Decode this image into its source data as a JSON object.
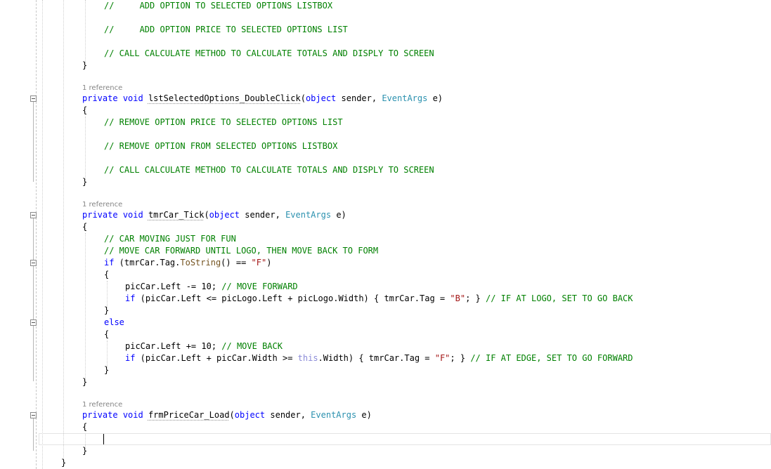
{
  "editor": {
    "lines": [
      {
        "tokens": [
          {
            "t": "//     ADD OPTION TO SELECTED OPTIONS LISTBOX",
            "c": "cm"
          }
        ]
      },
      {
        "tokens": [
          {
            "t": "//     ADD OPTION PRICE TO SELECTED OPTIONS LIST",
            "c": "cm"
          }
        ]
      },
      {
        "tokens": [
          {
            "t": "// CALL CALCULATE METHOD TO CALCULATE TOTALS AND DISPLY TO SCREEN",
            "c": "cm"
          }
        ]
      },
      {
        "tokens": [
          {
            "t": "}",
            "c": ""
          }
        ]
      },
      {
        "tokens": [
          {
            "t": "private",
            "c": "kw"
          },
          {
            "t": " ",
            "c": ""
          },
          {
            "t": "void",
            "c": "kw"
          },
          {
            "t": " ",
            "c": ""
          },
          {
            "t": "lstSelectedOptions_DoubleClick",
            "c": "mname"
          },
          {
            "t": "(",
            "c": ""
          },
          {
            "t": "object",
            "c": "kw"
          },
          {
            "t": " sender, ",
            "c": ""
          },
          {
            "t": "EventArgs",
            "c": "ty"
          },
          {
            "t": " e)",
            "c": ""
          }
        ]
      },
      {
        "tokens": [
          {
            "t": "{",
            "c": ""
          }
        ]
      },
      {
        "tokens": [
          {
            "t": "// REMOVE OPTION PRICE TO SELECTED OPTIONS LIST",
            "c": "cm"
          }
        ]
      },
      {
        "tokens": [
          {
            "t": "// REMOVE OPTION FROM SELECTED OPTIONS LISTBOX",
            "c": "cm"
          }
        ]
      },
      {
        "tokens": [
          {
            "t": "// CALL CALCULATE METHOD TO CALCULATE TOTALS AND DISPLY TO SCREEN",
            "c": "cm"
          }
        ]
      },
      {
        "tokens": [
          {
            "t": "}",
            "c": ""
          }
        ]
      },
      {
        "tokens": [
          {
            "t": "private",
            "c": "kw"
          },
          {
            "t": " ",
            "c": ""
          },
          {
            "t": "void",
            "c": "kw"
          },
          {
            "t": " ",
            "c": ""
          },
          {
            "t": "tmrCar_Tick",
            "c": "mname"
          },
          {
            "t": "(",
            "c": ""
          },
          {
            "t": "object",
            "c": "kw"
          },
          {
            "t": " sender, ",
            "c": ""
          },
          {
            "t": "EventArgs",
            "c": "ty"
          },
          {
            "t": " e)",
            "c": ""
          }
        ]
      },
      {
        "tokens": [
          {
            "t": "{",
            "c": ""
          }
        ]
      },
      {
        "tokens": [
          {
            "t": "// CAR MOVING JUST FOR FUN",
            "c": "cm"
          }
        ]
      },
      {
        "tokens": [
          {
            "t": "// MOVE CAR FORWARD UNTIL LOGO, THEN MOVE BACK TO FORM",
            "c": "cm"
          }
        ]
      },
      {
        "tokens": [
          {
            "t": "if",
            "c": "kw"
          },
          {
            "t": " (tmrCar.Tag.",
            "c": ""
          },
          {
            "t": "ToString",
            "c": "me"
          },
          {
            "t": "() == ",
            "c": ""
          },
          {
            "t": "\"F\"",
            "c": "str"
          },
          {
            "t": ")",
            "c": ""
          }
        ]
      },
      {
        "tokens": [
          {
            "t": "{",
            "c": ""
          }
        ]
      },
      {
        "tokens": [
          {
            "t": "picCar.Left -= 10; ",
            "c": ""
          },
          {
            "t": "// MOVE FORWARD",
            "c": "cm"
          }
        ]
      },
      {
        "tokens": [
          {
            "t": "if",
            "c": "kw"
          },
          {
            "t": " (picCar.Left <= picLogo.Left + picLogo.Width) { tmrCar.Tag = ",
            "c": ""
          },
          {
            "t": "\"B\"",
            "c": "str"
          },
          {
            "t": "; } ",
            "c": ""
          },
          {
            "t": "// IF AT LOGO, SET TO GO BACK",
            "c": "cm"
          }
        ]
      },
      {
        "tokens": [
          {
            "t": "}",
            "c": ""
          }
        ]
      },
      {
        "tokens": [
          {
            "t": "else",
            "c": "kw"
          }
        ]
      },
      {
        "tokens": [
          {
            "t": "{",
            "c": ""
          }
        ]
      },
      {
        "tokens": [
          {
            "t": "picCar.Left += 10; ",
            "c": ""
          },
          {
            "t": "// MOVE BACK",
            "c": "cm"
          }
        ]
      },
      {
        "tokens": [
          {
            "t": "if",
            "c": "kw"
          },
          {
            "t": " (picCar.Left + picCar.Width >= ",
            "c": ""
          },
          {
            "t": "this",
            "c": "kw-light"
          },
          {
            "t": ".Width) { tmrCar.Tag = ",
            "c": ""
          },
          {
            "t": "\"F\"",
            "c": "str"
          },
          {
            "t": "; } ",
            "c": ""
          },
          {
            "t": "// IF AT EDGE, SET TO GO FORWARD",
            "c": "cm"
          }
        ]
      },
      {
        "tokens": [
          {
            "t": "}",
            "c": ""
          }
        ]
      },
      {
        "tokens": [
          {
            "t": "}",
            "c": ""
          }
        ]
      },
      {
        "tokens": [
          {
            "t": "private",
            "c": "kw"
          },
          {
            "t": " ",
            "c": ""
          },
          {
            "t": "void",
            "c": "kw"
          },
          {
            "t": " ",
            "c": ""
          },
          {
            "t": "frmPriceCar_Load",
            "c": "mname"
          },
          {
            "t": "(",
            "c": ""
          },
          {
            "t": "object",
            "c": "kw"
          },
          {
            "t": " sender, ",
            "c": ""
          },
          {
            "t": "EventArgs",
            "c": "ty"
          },
          {
            "t": " e)",
            "c": ""
          }
        ]
      },
      {
        "tokens": [
          {
            "t": "{",
            "c": ""
          }
        ]
      },
      {
        "tokens": [
          {
            "t": "}",
            "c": ""
          }
        ]
      },
      {
        "tokens": [
          {
            "t": "}",
            "c": ""
          }
        ]
      }
    ],
    "references": [
      "1 reference",
      "1 reference",
      "1 reference"
    ]
  }
}
